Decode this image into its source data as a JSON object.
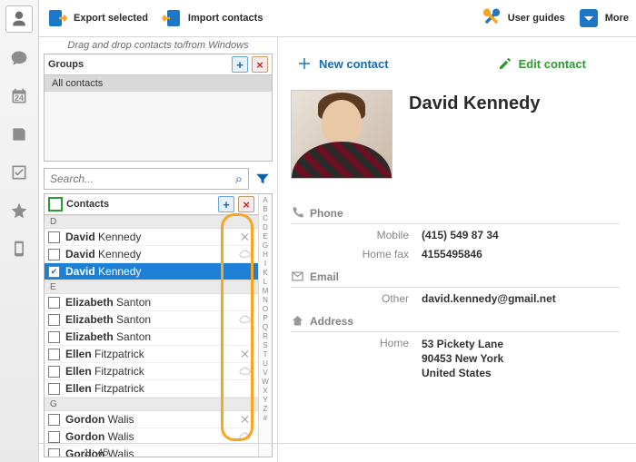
{
  "toolbar": {
    "export": "Export selected",
    "import": "Import contacts",
    "guides": "User guides",
    "more": "More"
  },
  "left": {
    "hint": "Drag and drop contacts to/from Windows",
    "groups_title": "Groups",
    "group_all": "All contacts",
    "search_placeholder": "Search...",
    "contacts_title": "Contacts",
    "sections": {
      "d": "D",
      "e": "E",
      "g": "G"
    },
    "rows": [
      {
        "first": "David",
        "last": "Kennedy",
        "sel": false,
        "icon": "x"
      },
      {
        "first": "David",
        "last": "Kennedy",
        "sel": false,
        "icon": "cloud"
      },
      {
        "first": "David",
        "last": "Kennedy",
        "sel": true,
        "icon": ""
      },
      {
        "first": "Elizabeth",
        "last": "Santon",
        "sel": false,
        "icon": ""
      },
      {
        "first": "Elizabeth",
        "last": "Santon",
        "sel": false,
        "icon": "cloud"
      },
      {
        "first": "Elizabeth",
        "last": "Santon",
        "sel": false,
        "icon": ""
      },
      {
        "first": "Ellen",
        "last": "Fitzpatrick",
        "sel": false,
        "icon": "x"
      },
      {
        "first": "Ellen",
        "last": "Fitzpatrick",
        "sel": false,
        "icon": "cloud"
      },
      {
        "first": "Ellen",
        "last": "Fitzpatrick",
        "sel": false,
        "icon": ""
      },
      {
        "first": "Gordon",
        "last": "Walis",
        "sel": false,
        "icon": "x"
      },
      {
        "first": "Gordon",
        "last": "Walis",
        "sel": false,
        "icon": "cloud"
      },
      {
        "first": "Gordon",
        "last": "Walis",
        "sel": false,
        "icon": ""
      }
    ],
    "alpha": [
      "A",
      "B",
      "C",
      "D",
      "E",
      "G",
      "H",
      "I",
      "K",
      "L",
      "M",
      "N",
      "O",
      "P",
      "Q",
      "R",
      "S",
      "T",
      "U",
      "V",
      "W",
      "X",
      "Y",
      "Z",
      "#"
    ]
  },
  "actions": {
    "new": "New contact",
    "edit": "Edit contact"
  },
  "contact": {
    "name": "David Kennedy",
    "phone_title": "Phone",
    "email_title": "Email",
    "address_title": "Address",
    "phone": [
      {
        "k": "Mobile",
        "v": "(415) 549 87 34"
      },
      {
        "k": "Home fax",
        "v": "4155495846"
      }
    ],
    "email": [
      {
        "k": "Other",
        "v": "david.kennedy@gmail.net"
      }
    ],
    "address": {
      "k": "Home",
      "l1": "53 Pickety Lane",
      "l2": "90453 New York",
      "l3": "United States"
    }
  },
  "rail_cal": "24",
  "status": "1 : 45"
}
